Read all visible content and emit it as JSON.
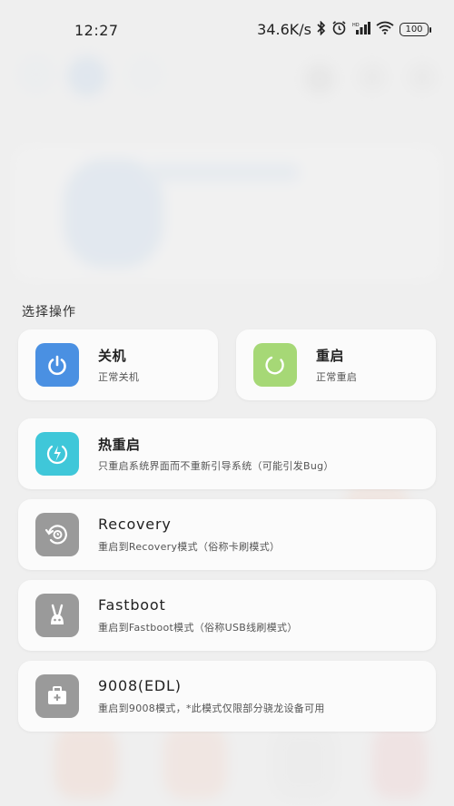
{
  "status_bar": {
    "time": "12:27",
    "speed": "34.6K/s",
    "battery": "100"
  },
  "section_title": "选择操作",
  "colors": {
    "power_off": "#4a90e2",
    "reboot": "#a6d876",
    "hot_reboot": "#3fc7d9",
    "gray_icon": "#9a9a9a"
  },
  "actions": {
    "power_off": {
      "title": "关机",
      "desc": "正常关机",
      "icon": "power-icon"
    },
    "reboot": {
      "title": "重启",
      "desc": "正常重启",
      "icon": "restart-icon"
    },
    "hot_reboot": {
      "title": "热重启",
      "desc": "只重启系统界面而不重新引导系统（可能引发Bug）",
      "icon": "bolt-icon"
    },
    "recovery": {
      "title": "Recovery",
      "desc": "重启到Recovery模式（俗称卡刷模式）",
      "icon": "recovery-icon"
    },
    "fastboot": {
      "title": "Fastboot",
      "desc": "重启到Fastboot模式（俗称USB线刷模式）",
      "icon": "rabbit-icon"
    },
    "edl": {
      "title": "9008(EDL)",
      "desc": "重启到9008模式，*此模式仅限部分骁龙设备可用",
      "icon": "toolbox-icon"
    }
  }
}
